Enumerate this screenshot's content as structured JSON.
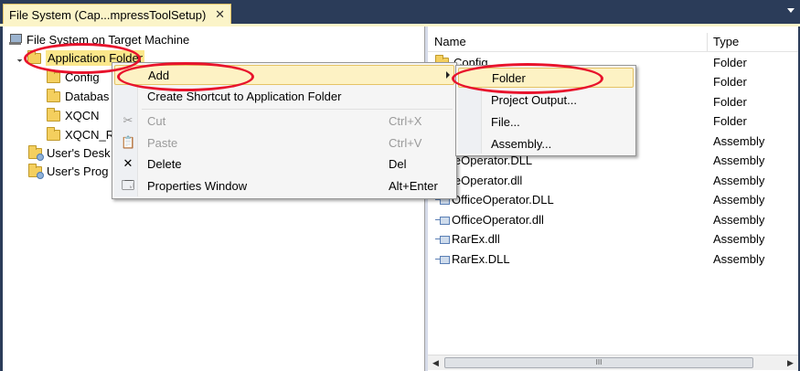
{
  "tab": {
    "title": "File System (Cap...mpressToolSetup)",
    "close_glyph": "✕"
  },
  "tree": {
    "root": "File System on Target Machine",
    "app_folder": "Application Folder",
    "children": [
      "Config",
      "Databas",
      "XQCN",
      "XQCN_R"
    ],
    "user_desktop": "User's Desk",
    "user_programs": "User's Prog"
  },
  "list": {
    "header_name": "Name",
    "header_type": "Type",
    "rows": [
      {
        "name": "Config",
        "type": "Folder"
      },
      {
        "name": "",
        "type": "Folder"
      },
      {
        "name": "",
        "type": "Folder"
      },
      {
        "name": "",
        "type": "Folder"
      },
      {
        "name": "",
        "type": "Assembly"
      },
      {
        "name": "leOperator.DLL",
        "type": "Assembly"
      },
      {
        "name": "leOperator.dll",
        "type": "Assembly"
      },
      {
        "name": "OfficeOperator.DLL",
        "type": "Assembly"
      },
      {
        "name": "OfficeOperator.dll",
        "type": "Assembly"
      },
      {
        "name": "RarEx.dll",
        "type": "Assembly"
      },
      {
        "name": "RarEx.DLL",
        "type": "Assembly"
      }
    ]
  },
  "context_menu": {
    "add": "Add",
    "create_shortcut": "Create Shortcut to Application Folder",
    "cut": "Cut",
    "cut_shortcut": "Ctrl+X",
    "paste": "Paste",
    "paste_shortcut": "Ctrl+V",
    "delete": "Delete",
    "delete_shortcut": "Del",
    "properties": "Properties Window",
    "properties_shortcut": "Alt+Enter"
  },
  "submenu": {
    "folder": "Folder",
    "project_output": "Project Output...",
    "file": "File...",
    "assembly": "Assembly..."
  },
  "scrollbar": {
    "thumb_grip": "III"
  },
  "colors": {
    "annotation_red": "#e8132c",
    "highlight": "#fdf2c4",
    "tab_bg": "#fbf4c8",
    "frame": "#2b3c59"
  }
}
